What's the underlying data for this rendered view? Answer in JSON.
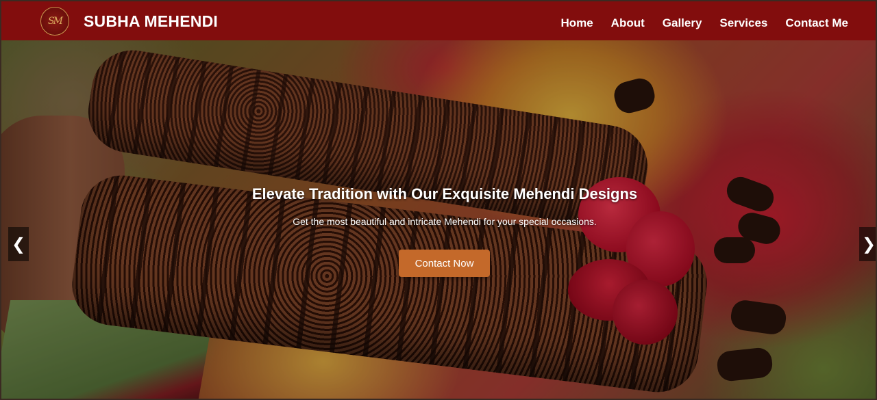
{
  "brand": {
    "logo_text": "SM",
    "name": "SUBHA MEHENDI"
  },
  "nav": {
    "items": [
      {
        "label": "Home"
      },
      {
        "label": "About"
      },
      {
        "label": "Gallery"
      },
      {
        "label": "Services"
      },
      {
        "label": "Contact Me"
      }
    ]
  },
  "hero": {
    "headline": "Elevate Tradition with Our Exquisite Mehendi Designs",
    "subheadline": "Get the most beautiful and intricate Mehendi for your special occasions.",
    "cta_label": "Contact Now",
    "prev_icon": "chevron-left-icon",
    "next_icon": "chevron-right-icon",
    "prev_glyph": "❮",
    "next_glyph": "❯"
  },
  "colors": {
    "navbar_bg": "#820d0d",
    "cta_bg": "#c4692a",
    "logo_gold": "#d9aa5e"
  }
}
